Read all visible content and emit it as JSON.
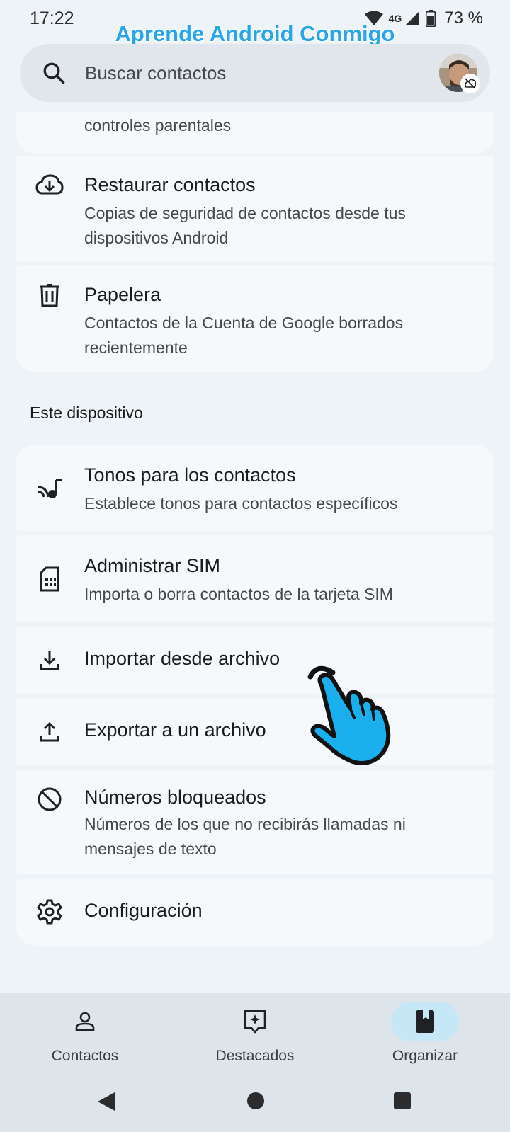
{
  "status_bar": {
    "time": "17:22",
    "network": "4G",
    "battery": "73 %"
  },
  "watermark": "Aprende Android Conmigo",
  "search": {
    "placeholder": "Buscar contactos"
  },
  "top_partial_card": {
    "subtitle": "controles parentales"
  },
  "google_items": [
    {
      "title": "Restaurar contactos",
      "subtitle": "Copias de seguridad de contactos desde tus dispositivos Android",
      "icon": "cloud-download-icon"
    },
    {
      "title": "Papelera",
      "subtitle": "Contactos de la Cuenta de Google borrados recientemente",
      "icon": "trash-icon"
    }
  ],
  "device_section": {
    "header": "Este dispositivo",
    "items": [
      {
        "title": "Tonos para los contactos",
        "subtitle": "Establece tonos para contactos específicos",
        "icon": "ringtone-icon"
      },
      {
        "title": "Administrar SIM",
        "subtitle": "Importa o borra contactos de la tarjeta SIM",
        "icon": "sim-card-icon"
      },
      {
        "title": "Importar desde archivo",
        "icon": "download-icon"
      },
      {
        "title": "Exportar a un archivo",
        "icon": "upload-icon"
      },
      {
        "title": "Números bloqueados",
        "subtitle": "Números de los que no recibirás llamadas ni mensajes de texto",
        "icon": "block-icon"
      },
      {
        "title": "Configuración",
        "icon": "gear-icon"
      }
    ]
  },
  "bottom_nav": {
    "items": [
      {
        "label": "Contactos",
        "icon": "person-icon",
        "active": false
      },
      {
        "label": "Destacados",
        "icon": "star-sparkle-icon",
        "active": false
      },
      {
        "label": "Organizar",
        "icon": "bookmark-book-icon",
        "active": true
      }
    ]
  },
  "colors": {
    "background": "#eef3f7",
    "card": "#f5f9fc",
    "active_indicator": "#c6e7f5",
    "watermark": "#2aa6e8",
    "pointer": "#1ab0ee"
  }
}
